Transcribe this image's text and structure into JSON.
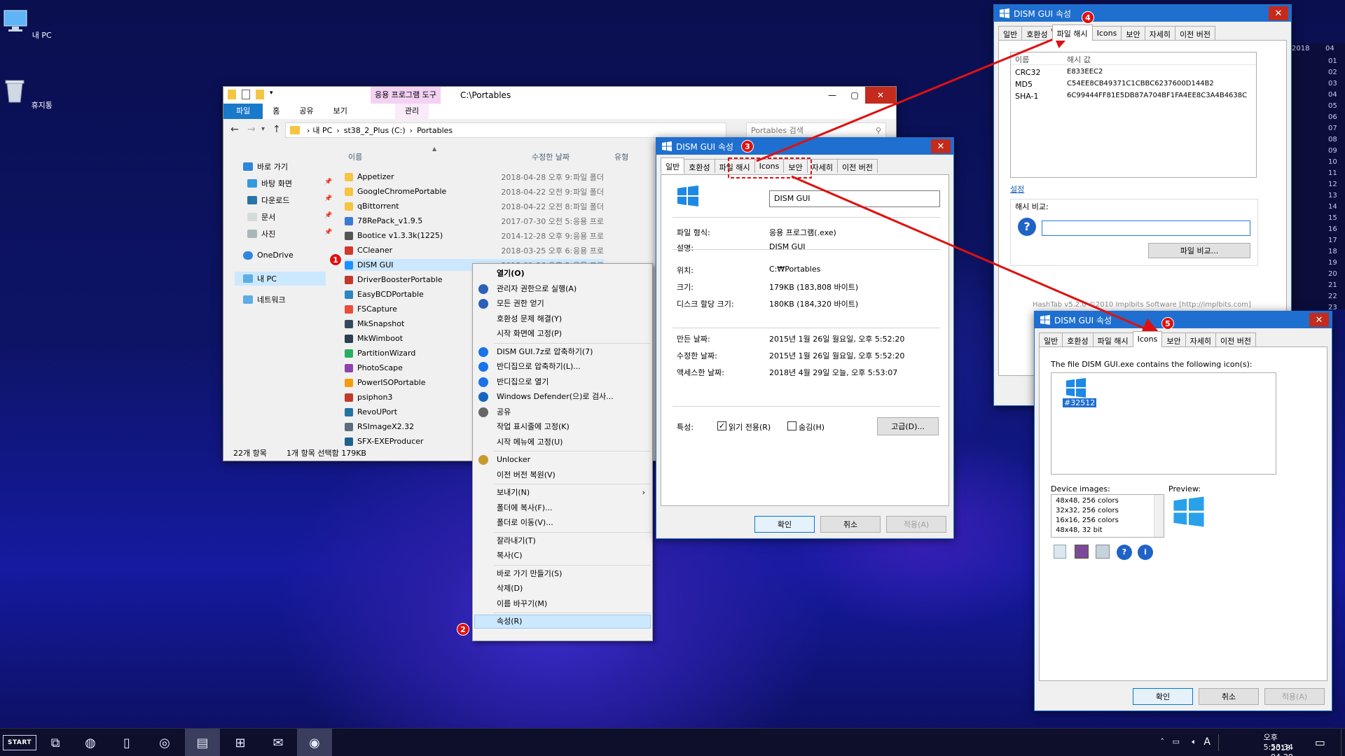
{
  "desktop": {
    "icons": [
      {
        "label": "내 PC",
        "icon": "computer-icon"
      },
      {
        "label": "휴지통",
        "icon": "recycle-bin-icon"
      }
    ]
  },
  "explorer": {
    "qat_tool_label": "응용 프로그램 도구",
    "path_title": "C:\\Portables",
    "ribbon_tabs": [
      "파일",
      "홈",
      "공유",
      "보기"
    ],
    "manage_tab": "관리",
    "address": {
      "root": "내 PC",
      "drive": "st38_2_Plus (C:)",
      "folder": "Portables"
    },
    "search_placeholder": "Portables 검색",
    "columns": {
      "name": "이름",
      "date": "수정한 날짜",
      "type": "유형"
    },
    "nav": [
      {
        "label": "바로 가기",
        "icon": "star-icon"
      },
      {
        "label": "바탕 화면",
        "icon": "desktop-icon"
      },
      {
        "label": "다운로드",
        "icon": "download-icon"
      },
      {
        "label": "문서",
        "icon": "documents-icon"
      },
      {
        "label": "사진",
        "icon": "pictures-icon"
      },
      {
        "label": "OneDrive",
        "icon": "onedrive-icon"
      },
      {
        "label": "내 PC",
        "icon": "this-pc-icon"
      },
      {
        "label": "네트워크",
        "icon": "network-icon"
      }
    ],
    "files": [
      {
        "name": "Appetizer",
        "date": "2018-04-28 오후 9:",
        "type": "파일 폴더",
        "color": "#f5c542"
      },
      {
        "name": "GoogleChromePortable",
        "date": "2018-04-22 오전 9:",
        "type": "파일 폴더",
        "color": "#f5c542"
      },
      {
        "name": "qBittorrent",
        "date": "2018-04-22 오전 8:",
        "type": "파일 폴더",
        "color": "#f5c542"
      },
      {
        "name": "78RePack_v1.9.5",
        "date": "2017-07-30 오전 5:",
        "type": "응용 프로",
        "color": "#3a7bd5"
      },
      {
        "name": "Bootice v1.3.3k(1225)",
        "date": "2014-12-28 오후 9:",
        "type": "응용 프로",
        "color": "#555555"
      },
      {
        "name": "CCleaner",
        "date": "2018-03-25 오후 6:",
        "type": "응용 프로",
        "color": "#d13a2a"
      },
      {
        "name": "DISM GUI",
        "date": "2015-01-26 오후 5:",
        "type": "응용 프로",
        "color": "#1e90ff"
      },
      {
        "name": "DriverBoosterPortable",
        "date": "",
        "type": "",
        "color": "#c0392b"
      },
      {
        "name": "EasyBCDPortable",
        "date": "",
        "type": "",
        "color": "#2e86c1"
      },
      {
        "name": "FSCapture",
        "date": "",
        "type": "",
        "color": "#e74c3c"
      },
      {
        "name": "MkSnapshot",
        "date": "",
        "type": "",
        "color": "#34495e"
      },
      {
        "name": "MkWimboot",
        "date": "",
        "type": "",
        "color": "#2c3e50"
      },
      {
        "name": "PartitionWizard",
        "date": "",
        "type": "",
        "color": "#27ae60"
      },
      {
        "name": "PhotoScape",
        "date": "",
        "type": "",
        "color": "#8e44ad"
      },
      {
        "name": "PowerISOPortable",
        "date": "",
        "type": "",
        "color": "#f39c12"
      },
      {
        "name": "psiphon3",
        "date": "",
        "type": "",
        "color": "#c0392b"
      },
      {
        "name": "RevoUPort",
        "date": "",
        "type": "",
        "color": "#2471a3"
      },
      {
        "name": "RSImageX2.32",
        "date": "",
        "type": "",
        "color": "#5d6d7e"
      },
      {
        "name": "SFX-EXEProducer",
        "date": "",
        "type": "",
        "color": "#1f618d"
      }
    ],
    "status_count": "22개 항목",
    "status_selected": "1개 항목 선택함 179KB"
  },
  "context_menu": {
    "items": [
      {
        "label": "열기(O)",
        "bold": true
      },
      {
        "label": "관리자 권한으로 실행(A)",
        "icon": "shield-icon"
      },
      {
        "label": "모든 권한 얻기",
        "icon": "shield-icon"
      },
      {
        "label": "호환성 문제 해결(Y)"
      },
      {
        "label": "시작 화면에 고정(P)"
      },
      {
        "label": "DISM GUI.7z로 압축하기(7)",
        "icon": "bandizip-icon"
      },
      {
        "label": "반디집으로 압축하기(L)...",
        "icon": "bandizip-icon"
      },
      {
        "label": "반디집으로 열기",
        "icon": "bandizip-icon"
      },
      {
        "label": "Windows Defender(으)로 검사...",
        "icon": "defender-icon"
      },
      {
        "label": "공유",
        "icon": "share-icon"
      },
      {
        "label": "작업 표시줄에 고정(K)"
      },
      {
        "label": "시작 메뉴에 고정(U)"
      },
      {
        "label": "Unlocker",
        "icon": "unlocker-icon"
      },
      {
        "label": "이전 버전 복원(V)"
      },
      {
        "label": "보내기(N)",
        "submenu": true
      },
      {
        "label": "폴더에 복사(F)..."
      },
      {
        "label": "폴더로 이동(V)..."
      },
      {
        "label": "잘라내기(T)"
      },
      {
        "label": "복사(C)"
      },
      {
        "label": "바로 가기 만들기(S)"
      },
      {
        "label": "삭제(D)"
      },
      {
        "label": "이름 바꾸기(M)"
      },
      {
        "label": "속성(R)",
        "highlighted": true
      }
    ]
  },
  "dialog_general": {
    "title": "DISM GUI 속성",
    "tabs": [
      "일반",
      "호환성",
      "파일 해시",
      "Icons",
      "보안",
      "자세히",
      "이전 버전"
    ],
    "active_tab": "일반",
    "filename": "DISM GUI",
    "fields": [
      {
        "label": "파일 형식:",
        "value": "응용 프로그램(.exe)"
      },
      {
        "label": "설명:",
        "value": "DISM GUI"
      },
      {
        "label": "위치:",
        "value": "C:₩Portables"
      },
      {
        "label": "크기:",
        "value": "179KB (183,808 바이트)"
      },
      {
        "label": "디스크 할당 크기:",
        "value": "180KB (184,320 바이트)"
      },
      {
        "label": "만든 날짜:",
        "value": "2015년 1월 26일 월요일, 오후 5:52:20"
      },
      {
        "label": "수정한 날짜:",
        "value": "2015년 1월 26일 월요일, 오후 5:52:20"
      },
      {
        "label": "액세스한 날짜:",
        "value": "2018년 4월 29일 오늘, 오후 5:53:07"
      }
    ],
    "attributes_label": "특성:",
    "readonly_label": "읽기 전용(R)",
    "readonly_checked": true,
    "hidden_label": "숨김(H)",
    "hidden_checked": false,
    "advanced_button": "고급(D)...",
    "ok": "확인",
    "cancel": "취소",
    "apply": "적용(A)"
  },
  "dialog_hash": {
    "title": "DISM GUI 속성",
    "tabs": [
      "일반",
      "호환성",
      "파일 해시",
      "Icons",
      "보안",
      "자세히",
      "이전 버전"
    ],
    "active_tab": "파일 해시",
    "col_name": "이름",
    "col_value": "해시 값",
    "hashes": [
      {
        "name": "CRC32",
        "value": "E833EEC2"
      },
      {
        "name": "MD5",
        "value": "C54EE8CB49371C1CBBC6237600D144B2"
      },
      {
        "name": "SHA-1",
        "value": "6C99444FF81E5DB87A704BF1FA4EE8C3A4B4638C"
      }
    ],
    "settings_link": "설정",
    "compare_label": "해시 비교:",
    "compare_button": "파일 비교...",
    "footer": "HashTab v5.2.0 ©2010 Implbits Software [http://implbits.com]"
  },
  "dialog_icons": {
    "title": "DISM GUI 속성",
    "tabs": [
      "일반",
      "호환성",
      "파일 해시",
      "Icons",
      "보안",
      "자세히",
      "이전 버전"
    ],
    "active_tab": "Icons",
    "description": "The file DISM GUI.exe contains the following icon(s):",
    "icon_id": "#32512",
    "device_images_label": "Device images:",
    "device_images": [
      "48x48, 256 colors",
      "32x32, 256 colors",
      "16x16, 256 colors",
      "48x48, 32 bit"
    ],
    "preview_label": "Preview:",
    "ok": "확인",
    "cancel": "취소",
    "apply": "적용(A)"
  },
  "calendar_strip": {
    "header_year": "2018",
    "header_month": "04",
    "days": [
      "01",
      "02",
      "03",
      "04",
      "05",
      "06",
      "07",
      "08",
      "09",
      "10",
      "11",
      "12",
      "13",
      "14",
      "15",
      "16",
      "17",
      "18",
      "19",
      "20",
      "21",
      "22",
      "23"
    ]
  },
  "annotations": [
    "1",
    "2",
    "3",
    "4",
    "5"
  ],
  "taskbar": {
    "start_label": "START",
    "tray_lang": "A",
    "time": "오후 5:53:34",
    "date": "2018-04-29"
  },
  "colors": {
    "accent": "#1e6fcf",
    "badge": "#e01010",
    "selection": "#cce8ff"
  }
}
